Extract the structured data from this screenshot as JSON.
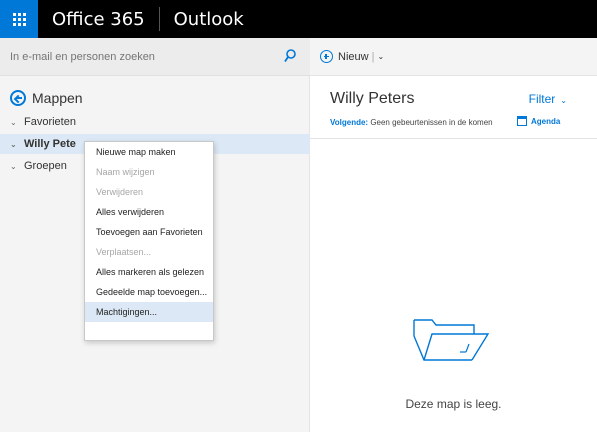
{
  "header": {
    "brand": "Office 365",
    "app": "Outlook"
  },
  "search": {
    "placeholder": "In e-mail en personen zoeken"
  },
  "nav": {
    "back_label": "Mappen",
    "items": [
      {
        "label": "Favorieten"
      },
      {
        "label": "Willy Pete"
      },
      {
        "label": "Groepen"
      }
    ]
  },
  "context_menu": {
    "items": [
      {
        "label": "Nieuwe map maken",
        "enabled": true
      },
      {
        "label": "Naam wijzigen",
        "enabled": false
      },
      {
        "label": "Verwijderen",
        "enabled": false
      },
      {
        "label": "Alles verwijderen",
        "enabled": true
      },
      {
        "label": "Toevoegen aan Favorieten",
        "enabled": true
      },
      {
        "label": "Verplaatsen...",
        "enabled": false
      },
      {
        "label": "Alles markeren als gelezen",
        "enabled": true
      },
      {
        "label": "Gedeelde map toevoegen...",
        "enabled": true
      },
      {
        "label": "Machtigingen...",
        "enabled": true
      }
    ]
  },
  "toolbar": {
    "new_label": "Nieuw"
  },
  "main": {
    "title": "Willy Peters",
    "filter_label": "Filter",
    "next_label": "Volgende:",
    "next_text": "Geen gebeurtenissen in de komen",
    "agenda_label": "Agenda",
    "empty_text": "Deze map is leeg."
  },
  "colors": {
    "accent": "#0078d7",
    "topbar": "#000000",
    "selected": "#dce8f5"
  }
}
